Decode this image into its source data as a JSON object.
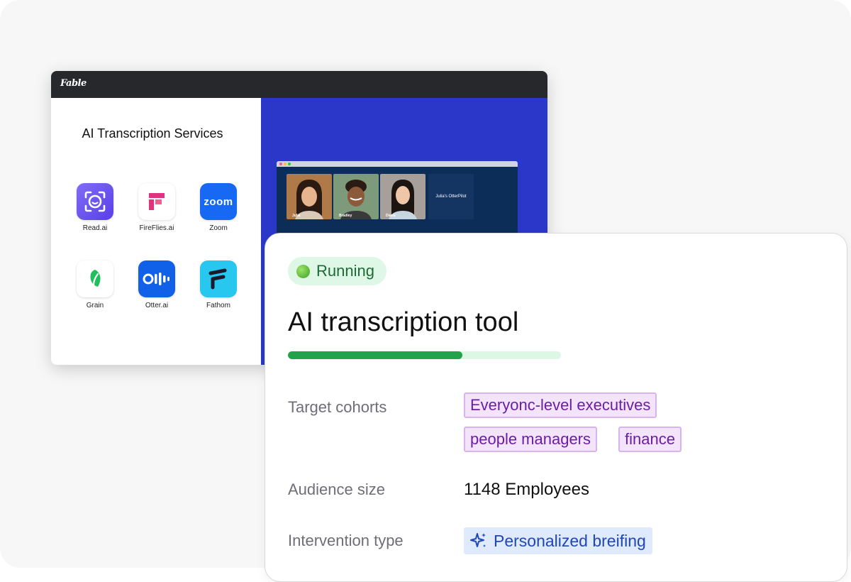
{
  "app": {
    "brand": "Fable",
    "section_title": "AI Transcription Services",
    "services": [
      {
        "name": "Read.ai",
        "icon": "read-ai-icon",
        "color": "#6e56f0"
      },
      {
        "name": "FireFlies.ai",
        "icon": "fireflies-icon",
        "color": "#e2317f"
      },
      {
        "name": "Zoom",
        "icon": "zoom-icon",
        "color": "#1769f3",
        "icon_text": "zoom"
      },
      {
        "name": "Grain",
        "icon": "grain-icon",
        "color": "#1fbf5e"
      },
      {
        "name": "Otter.ai",
        "icon": "otter-icon",
        "color": "#1160e8"
      },
      {
        "name": "Fathom",
        "icon": "fathom-icon",
        "color": "#27c7f0"
      }
    ],
    "meeting": {
      "participants": [
        "Julia",
        "Bradley",
        "Diana"
      ],
      "bot_label": "Julia's OtterPilot"
    }
  },
  "card": {
    "status": "Running",
    "status_color": "#1c6b35",
    "title": "AI transcription tool",
    "progress": 0.64,
    "target_cohorts_label": "Target cohorts",
    "cohorts": [
      "Everyonc-level executives",
      "people managers",
      "finance"
    ],
    "audience_size_label": "Audience size",
    "audience_size_value": "1148 Employees",
    "intervention_type_label": "Intervention type",
    "intervention_type_value": "Personalized breifing",
    "intervention_icon": "sparkle-icon"
  }
}
